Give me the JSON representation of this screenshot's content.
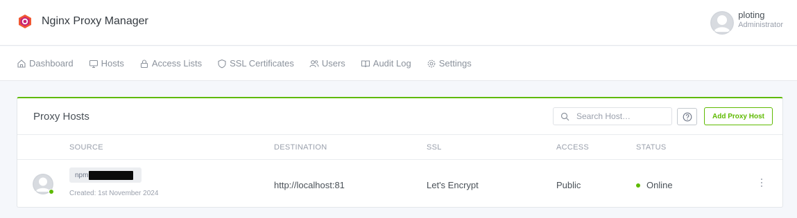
{
  "app": {
    "title": "Nginx Proxy Manager",
    "logo_icon": "nginx-proxy-manager-logo"
  },
  "user": {
    "name": "ploting",
    "role": "Administrator",
    "avatar_icon": "avatar-icon"
  },
  "nav": {
    "items": [
      {
        "label": "Dashboard",
        "icon": "home-icon"
      },
      {
        "label": "Hosts",
        "icon": "monitor-icon"
      },
      {
        "label": "Access Lists",
        "icon": "lock-icon"
      },
      {
        "label": "SSL Certificates",
        "icon": "shield-icon"
      },
      {
        "label": "Users",
        "icon": "users-icon"
      },
      {
        "label": "Audit Log",
        "icon": "book-icon"
      },
      {
        "label": "Settings",
        "icon": "gear-icon"
      }
    ]
  },
  "card": {
    "title": "Proxy Hosts",
    "search_placeholder": "Search Host…",
    "help_icon": "help-icon",
    "add_label": "Add Proxy Host",
    "accent_color": "#5eba00"
  },
  "table": {
    "columns": [
      "SOURCE",
      "DESTINATION",
      "SSL",
      "ACCESS",
      "STATUS"
    ],
    "rows": [
      {
        "source": "npm",
        "created": "Created: 1st November 2024",
        "destination": "http://localhost:81",
        "ssl": "Let's Encrypt",
        "access": "Public",
        "status": "Online",
        "status_color": "#5eba00"
      }
    ]
  }
}
